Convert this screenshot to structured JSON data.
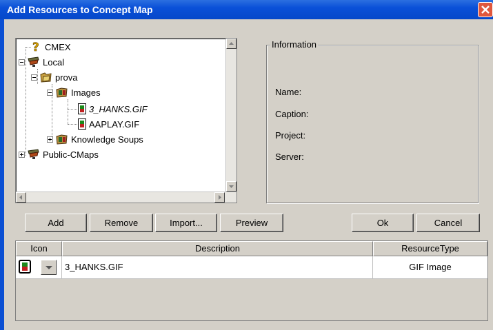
{
  "window": {
    "title": "Add Resources to Concept Map"
  },
  "tree": {
    "items": [
      {
        "label": "CMEX",
        "icon": "question-mark-icon"
      },
      {
        "label": "Local",
        "icon": "server-icon"
      },
      {
        "label": "prova",
        "icon": "folder-icon"
      },
      {
        "label": "Images",
        "icon": "folder-images-icon"
      },
      {
        "label": "3_HANKS.GIF",
        "icon": "gif-file-icon"
      },
      {
        "label": "AAPLAY.GIF",
        "icon": "gif-file-icon"
      },
      {
        "label": "Knowledge Soups",
        "icon": "folder-images-icon"
      },
      {
        "label": "Public-CMaps",
        "icon": "server-icon"
      }
    ]
  },
  "info": {
    "legend": "Information",
    "name_label": "Name:",
    "caption_label": "Caption:",
    "project_label": "Project:",
    "server_label": "Server:"
  },
  "buttons": {
    "add": "Add",
    "remove": "Remove",
    "import": "Import...",
    "preview": "Preview",
    "ok": "Ok",
    "cancel": "Cancel"
  },
  "table": {
    "headers": [
      "Icon",
      "Description",
      "ResourceType"
    ],
    "rows": [
      {
        "description": "3_HANKS.GIF",
        "type": "GIF Image"
      }
    ]
  },
  "colors": {
    "titlebar": "#0a50d8",
    "close": "#e0573d"
  }
}
